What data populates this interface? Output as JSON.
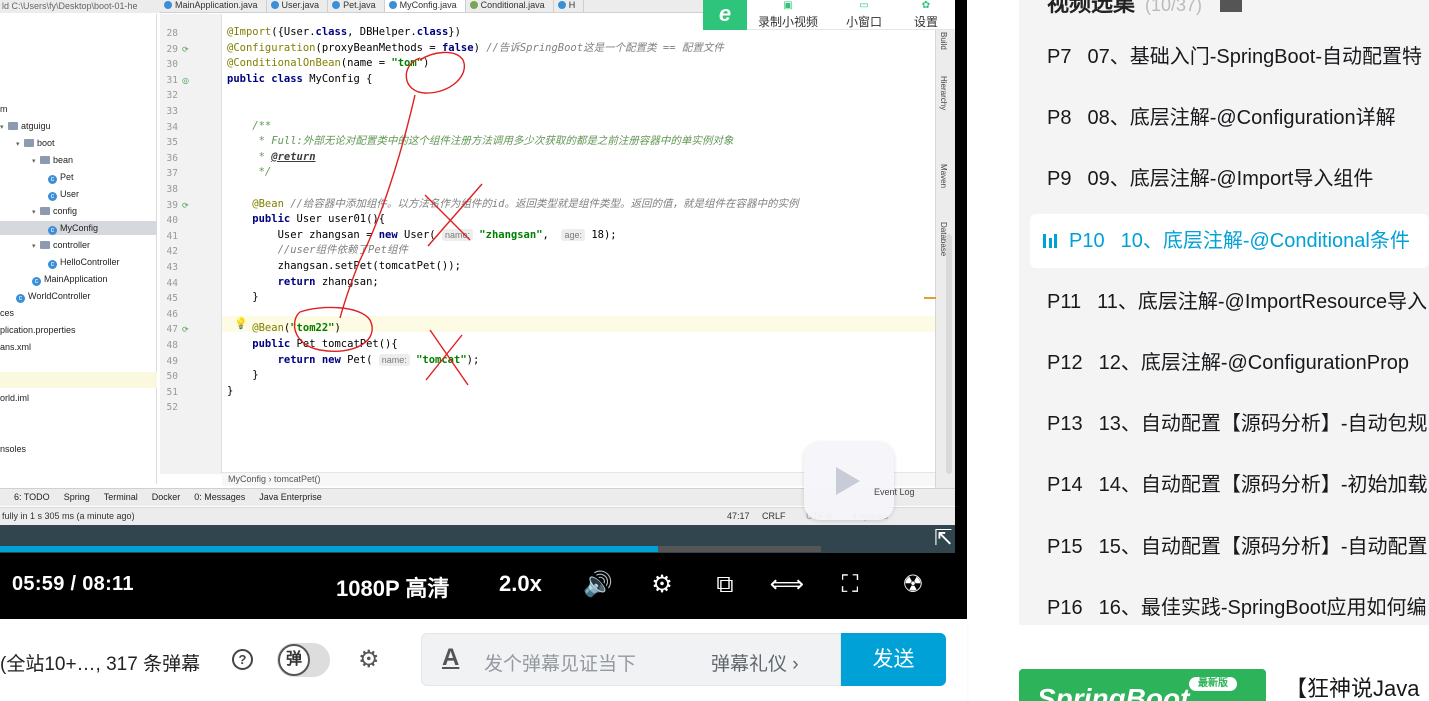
{
  "ide": {
    "top_tools_text": "ld  C:\\Users\\fy\\Desktop\\boot-01-he",
    "tabs": [
      {
        "label": "MainApplication.java",
        "kind": "class"
      },
      {
        "label": "User.java",
        "kind": "class"
      },
      {
        "label": "Pet.java",
        "kind": "class"
      },
      {
        "label": "MyConfig.java",
        "kind": "class",
        "active": true
      },
      {
        "label": "Conditional.java",
        "kind": "annotation"
      },
      {
        "label": "H",
        "kind": "class"
      }
    ],
    "tree": [
      {
        "label": "m",
        "indent": 0,
        "type": "text"
      },
      {
        "label": "atguigu",
        "indent": 0,
        "type": "folder",
        "arrow": "v"
      },
      {
        "label": "boot",
        "indent": 1,
        "type": "folder",
        "arrow": "v"
      },
      {
        "label": "bean",
        "indent": 2,
        "type": "folder",
        "arrow": "v"
      },
      {
        "label": "Pet",
        "indent": 3,
        "type": "class"
      },
      {
        "label": "User",
        "indent": 3,
        "type": "class"
      },
      {
        "label": "config",
        "indent": 2,
        "type": "folder",
        "arrow": "v"
      },
      {
        "label": "MyConfig",
        "indent": 3,
        "type": "class",
        "selected": true
      },
      {
        "label": "controller",
        "indent": 2,
        "type": "folder",
        "arrow": "v"
      },
      {
        "label": "HelloController",
        "indent": 3,
        "type": "class"
      },
      {
        "label": "MainApplication",
        "indent": 2,
        "type": "class"
      },
      {
        "label": "WorldController",
        "indent": 1,
        "type": "class"
      },
      {
        "label": "ces",
        "indent": 0,
        "type": "text"
      },
      {
        "label": "plication.properties",
        "indent": 0,
        "type": "text"
      },
      {
        "label": "ans.xml",
        "indent": 0,
        "type": "text"
      },
      {
        "label": "",
        "indent": 0,
        "type": "text"
      },
      {
        "label": "",
        "indent": 0,
        "type": "text"
      },
      {
        "label": "orld.iml",
        "indent": 0,
        "type": "text"
      },
      {
        "label": "",
        "indent": 0,
        "type": "text"
      },
      {
        "label": "",
        "indent": 0,
        "type": "text"
      },
      {
        "label": "nsoles",
        "indent": 0,
        "type": "text"
      }
    ],
    "line_numbers": [
      "28",
      "29",
      "30",
      "31",
      "32",
      "33",
      "34",
      "35",
      "36",
      "37",
      "38",
      "39",
      "40",
      "41",
      "42",
      "43",
      "44",
      "45",
      "46",
      "47",
      "48",
      "49",
      "50",
      "51",
      "52"
    ],
    "code_lines": [
      [
        {
          "t": "@Import",
          "c": "an"
        },
        {
          "t": "({User.",
          "c": ""
        },
        {
          "t": "class",
          "c": "kw"
        },
        {
          "t": ", DBHelper.",
          "c": ""
        },
        {
          "t": "class",
          "c": "kw"
        },
        {
          "t": "})",
          "c": ""
        }
      ],
      [
        {
          "t": "@Configuration",
          "c": "an"
        },
        {
          "t": "(proxyBeanMethods = ",
          "c": ""
        },
        {
          "t": "false",
          "c": "kw"
        },
        {
          "t": ") ",
          "c": ""
        },
        {
          "t": "//告诉SpringBoot这是一个配置类 == 配置文件",
          "c": "cm"
        }
      ],
      [
        {
          "t": "@ConditionalOnBean",
          "c": "an"
        },
        {
          "t": "(name = ",
          "c": ""
        },
        {
          "t": "\"tom\"",
          "c": "st"
        },
        {
          "t": ")",
          "c": ""
        }
      ],
      [
        {
          "t": "public class ",
          "c": "kw"
        },
        {
          "t": "MyConfig {",
          "c": ""
        }
      ],
      [],
      [],
      [
        {
          "t": "    /**",
          "c": "dc"
        }
      ],
      [
        {
          "t": "     * Full:外部无论对配置类中的这个组件注册方法调用多少次获取的都是之前注册容器中的单实例对象",
          "c": "dc"
        }
      ],
      [
        {
          "t": "     * ",
          "c": "dc"
        },
        {
          "t": "@return",
          "c": "dt"
        }
      ],
      [
        {
          "t": "     */",
          "c": "dc"
        }
      ],
      [],
      [
        {
          "t": "    @Bean ",
          "c": "an"
        },
        {
          "t": "//给容器中添加组件。以方法名作为组件的id。返回类型就是组件类型。返回的值，就是组件在容器中的实例",
          "c": "cm"
        }
      ],
      [
        {
          "t": "    public ",
          "c": "kw"
        },
        {
          "t": "User user01(){",
          "c": ""
        }
      ],
      [
        {
          "t": "        User zhangsan = ",
          "c": ""
        },
        {
          "t": "new ",
          "c": "kw"
        },
        {
          "t": "User( ",
          "c": ""
        },
        {
          "t": "name:",
          "c": "hint"
        },
        {
          "t": " ",
          "c": ""
        },
        {
          "t": "\"zhangsan\"",
          "c": "st"
        },
        {
          "t": ",  ",
          "c": ""
        },
        {
          "t": "age:",
          "c": "hint"
        },
        {
          "t": " 18);",
          "c": ""
        }
      ],
      [
        {
          "t": "        //user组件依赖了Pet组件",
          "c": "cm"
        }
      ],
      [
        {
          "t": "        zhangsan.setPet(tomcatPet());",
          "c": ""
        }
      ],
      [
        {
          "t": "        return ",
          "c": "kw"
        },
        {
          "t": "zhangsan;",
          "c": ""
        }
      ],
      [
        {
          "t": "    }",
          "c": ""
        }
      ],
      [],
      [
        {
          "t": "    @Bean",
          "c": "an"
        },
        {
          "t": "(",
          "c": ""
        },
        {
          "t": "\"tom22\"",
          "c": "st"
        },
        {
          "t": ")",
          "c": ""
        }
      ],
      [
        {
          "t": "    public ",
          "c": "kw"
        },
        {
          "t": "Pet tomcatPet(){",
          "c": ""
        }
      ],
      [
        {
          "t": "        return new ",
          "c": "kw"
        },
        {
          "t": "Pet( ",
          "c": ""
        },
        {
          "t": "name:",
          "c": "hint"
        },
        {
          "t": " ",
          "c": ""
        },
        {
          "t": "\"tomcat\"",
          "c": "st"
        },
        {
          "t": ");",
          "c": ""
        }
      ],
      [
        {
          "t": "    }",
          "c": ""
        }
      ],
      [
        {
          "t": "}",
          "c": ""
        }
      ],
      []
    ],
    "breadcrumb": [
      "MyConfig",
      "tomcatPet()"
    ],
    "right_tabs": [
      "Build",
      "Hierarchy",
      "Maven",
      "Database"
    ],
    "tool_windows": [
      "6: TODO",
      "Spring",
      "Terminal",
      "Docker",
      "0: Messages",
      "Java Enterprise"
    ],
    "status_left": "fully in 1 s 305 ms (a minute ago)",
    "status_right": [
      "47:17",
      "CRLF",
      "UTF-8",
      "4 spaces"
    ],
    "event_log": "Event Log"
  },
  "overlay": {
    "logo": "e",
    "record_label": "录制小视频",
    "mini_window_label": "小窗口",
    "settings_label": "设置"
  },
  "player": {
    "current_time": "05:59",
    "separator": "/",
    "total_time": "08:11",
    "quality": "1080P 高清",
    "speed": "2.0x",
    "progress_fraction": 0.689,
    "buffer_fraction": 0.86
  },
  "danmaku": {
    "viewer_info": "(全站10+…, 317 条弹幕",
    "help": "?",
    "toggle_char": "弹",
    "placeholder": "发个弹幕见证当下",
    "etiquette": "弹幕礼仪",
    "send": "发送"
  },
  "playlist": {
    "title": "视频选集",
    "count": "(10/37)",
    "items": [
      {
        "num": "P7",
        "title": "07、基础入门-SpringBoot-自动配置特"
      },
      {
        "num": "P8",
        "title": "08、底层注解-@Configuration详解"
      },
      {
        "num": "P9",
        "title": "09、底层注解-@Import导入组件"
      },
      {
        "num": "P10",
        "title": "10、底层注解-@Conditional条件",
        "active": true
      },
      {
        "num": "P11",
        "title": "11、底层注解-@ImportResource导入"
      },
      {
        "num": "P12",
        "title": "12、底层注解-@ConfigurationProp"
      },
      {
        "num": "P13",
        "title": "13、自动配置【源码分析】-自动包规"
      },
      {
        "num": "P14",
        "title": "14、自动配置【源码分析】-初始加载"
      },
      {
        "num": "P15",
        "title": "15、自动配置【源码分析】-自动配置"
      },
      {
        "num": "P16",
        "title": "16、最佳实践-SpringBoot应用如何编"
      }
    ]
  },
  "recommend": {
    "thumb_text": "SpringBoot",
    "badge": "最新版",
    "title": "【狂神说Java"
  }
}
